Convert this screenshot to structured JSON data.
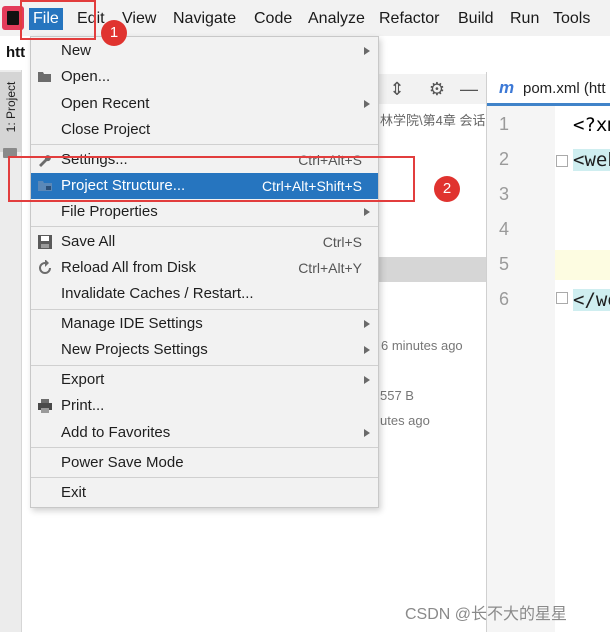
{
  "menubar": {
    "items": [
      {
        "label": "File",
        "active": true
      },
      {
        "label": "Edit"
      },
      {
        "label": "View"
      },
      {
        "label": "Navigate"
      },
      {
        "label": "Code"
      },
      {
        "label": "Analyze"
      },
      {
        "label": "Refactor"
      },
      {
        "label": "Build"
      },
      {
        "label": "Run"
      },
      {
        "label": "Tools"
      }
    ]
  },
  "toolbar": {
    "crumb": "htt"
  },
  "left_stripe": {
    "project_tab": "1: Project"
  },
  "project_panel": {
    "path_text": "林学院\\第4章 会话",
    "modified_1": "6 minutes ago",
    "size": "557 B",
    "modified_2": "utes ago"
  },
  "editor": {
    "tab_label": "pom.xml (htt",
    "line_numbers": [
      "1",
      "2",
      "3",
      "4",
      "5",
      "6"
    ],
    "code_lines": {
      "l1": "<?xm",
      "l2": "<web",
      "l6": "</we"
    }
  },
  "file_menu": {
    "items": [
      {
        "label": "New",
        "shortcut": "",
        "submenu": true
      },
      {
        "label": "Open...",
        "shortcut": "",
        "icon": "folder-open-icon"
      },
      {
        "label": "Open Recent",
        "shortcut": "",
        "submenu": true
      },
      {
        "label": "Close Project",
        "shortcut": ""
      },
      {
        "label": "Settings...",
        "shortcut": "Ctrl+Alt+S",
        "icon": "wrench-icon"
      },
      {
        "label": "Project Structure...",
        "shortcut": "Ctrl+Alt+Shift+S",
        "icon": "project-structure-icon",
        "selected": true
      },
      {
        "label": "File Properties",
        "shortcut": "",
        "submenu": true
      },
      {
        "label": "Save All",
        "shortcut": "Ctrl+S",
        "icon": "save-icon"
      },
      {
        "label": "Reload All from Disk",
        "shortcut": "Ctrl+Alt+Y",
        "icon": "reload-icon"
      },
      {
        "label": "Invalidate Caches / Restart...",
        "shortcut": ""
      },
      {
        "label": "Manage IDE Settings",
        "shortcut": "",
        "submenu": true
      },
      {
        "label": "New Projects Settings",
        "shortcut": "",
        "submenu": true
      },
      {
        "label": "Export",
        "shortcut": "",
        "submenu": true
      },
      {
        "label": "Print...",
        "shortcut": "",
        "icon": "printer-icon"
      },
      {
        "label": "Add to Favorites",
        "shortcut": "",
        "submenu": true
      },
      {
        "label": "Power Save Mode",
        "shortcut": ""
      },
      {
        "label": "Exit",
        "shortcut": ""
      }
    ]
  },
  "annotations": {
    "badge_1": "1",
    "badge_2": "2",
    "accent": "#e23d3d"
  },
  "watermark": "CSDN @长不大的星星",
  "colors": {
    "selection": "#2675bf",
    "menu_bg": "#f2f2f2"
  }
}
